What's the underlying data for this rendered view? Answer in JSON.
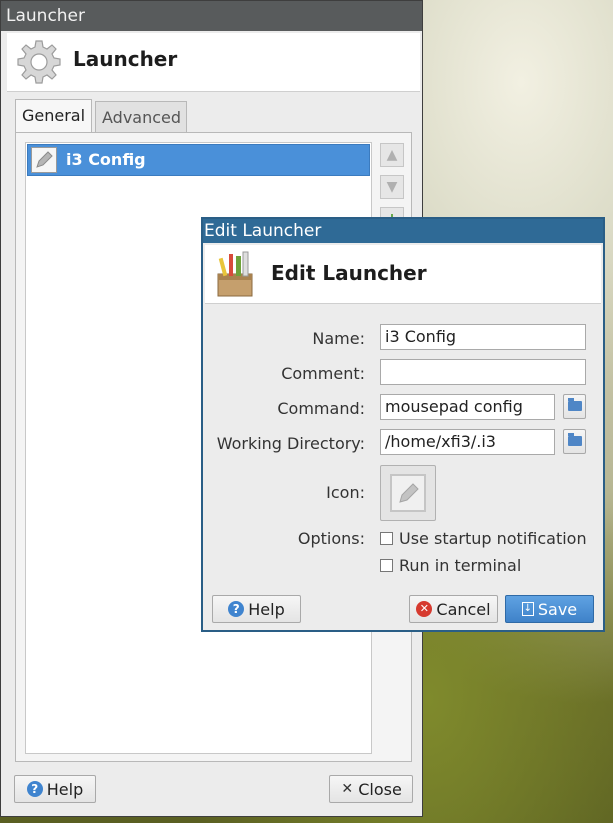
{
  "main_window": {
    "title": "Launcher",
    "header_title": "Launcher",
    "tabs": [
      {
        "label": "General",
        "active": true
      },
      {
        "label": "Advanced",
        "active": false
      }
    ],
    "items": [
      {
        "label": "i3 Config",
        "selected": true,
        "icon": "text-editor-icon"
      }
    ],
    "side_buttons": [
      "move-up-icon",
      "move-down-icon",
      "add-icon"
    ],
    "help_label": "Help",
    "close_label": "Close"
  },
  "edit_dialog": {
    "title": "Edit Launcher",
    "header_title": "Edit Launcher",
    "labels": {
      "name": "Name:",
      "comment": "Comment:",
      "command": "Command:",
      "working_directory": "Working Directory:",
      "icon": "Icon:",
      "options": "Options:"
    },
    "values": {
      "name": "i3 Config",
      "comment": "",
      "command": "mousepad config",
      "working_directory": "/home/xfi3/.i3"
    },
    "options": [
      {
        "label": "Use startup notification",
        "checked": false
      },
      {
        "label": "Run in terminal",
        "checked": false
      }
    ],
    "help_label": "Help",
    "cancel_label": "Cancel",
    "save_label": "Save"
  },
  "colors": {
    "main_titlebar": "#585b5c",
    "dialog_titlebar": "#2f6a96",
    "selection": "#4a90d9",
    "primary_button": "#4a8fd6"
  }
}
